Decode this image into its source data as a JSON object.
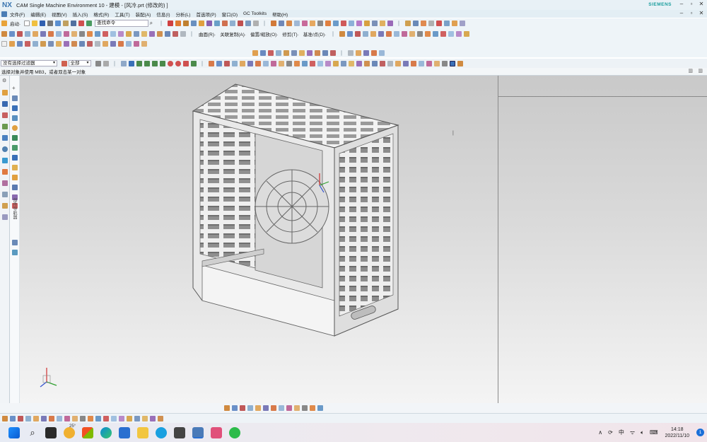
{
  "window": {
    "logo": "NX",
    "title": "CAM Single Machine Environment 10 - 建模 - [风冷.prt  (修改的)  ]",
    "brand": "SIEMENS",
    "controls": [
      "–",
      "▫",
      "✕"
    ],
    "doc_controls": [
      "–",
      "▫",
      "✕"
    ]
  },
  "menubar": {
    "items": [
      "文件(F)",
      "编辑(E)",
      "视图(V)",
      "插入(S)",
      "格式(R)",
      "工具(T)",
      "装配(A)",
      "信息(I)",
      "分析(L)",
      "首选项(P)",
      "窗口(O)",
      "GC Toolkits",
      "帮助(H)"
    ]
  },
  "toolbar1": {
    "start_label": "启动·",
    "command_search_placeholder": "查找命令"
  },
  "toolbar2": {
    "labels": [
      "曲面(R)·",
      "关联复制(A)·",
      "偏置/缩放(O)·",
      "修剪(T)·",
      "基准/点(D)·"
    ]
  },
  "selection_bar": {
    "filter": "没有选择过滤器",
    "scope": "全部"
  },
  "cue_line": {
    "text": "选择对象并使用 MB3，或者双击某一对象"
  },
  "navigator": {
    "vertical_label": "部件导航器"
  },
  "taskbar": {
    "temperature": "25°",
    "tray_ime": "中",
    "tray_symbols": [
      "∧",
      "⟳",
      "ᯤ",
      "🔈︎",
      "⌨"
    ],
    "time": "14:18",
    "date": "2022/11/10",
    "notifications": "1"
  },
  "colors": {
    "accent": "#3a75b0",
    "siemens_teal": "#1a9e9e",
    "viewport_top": "#c9c9c9",
    "viewport_bottom": "#f4f4f4"
  }
}
